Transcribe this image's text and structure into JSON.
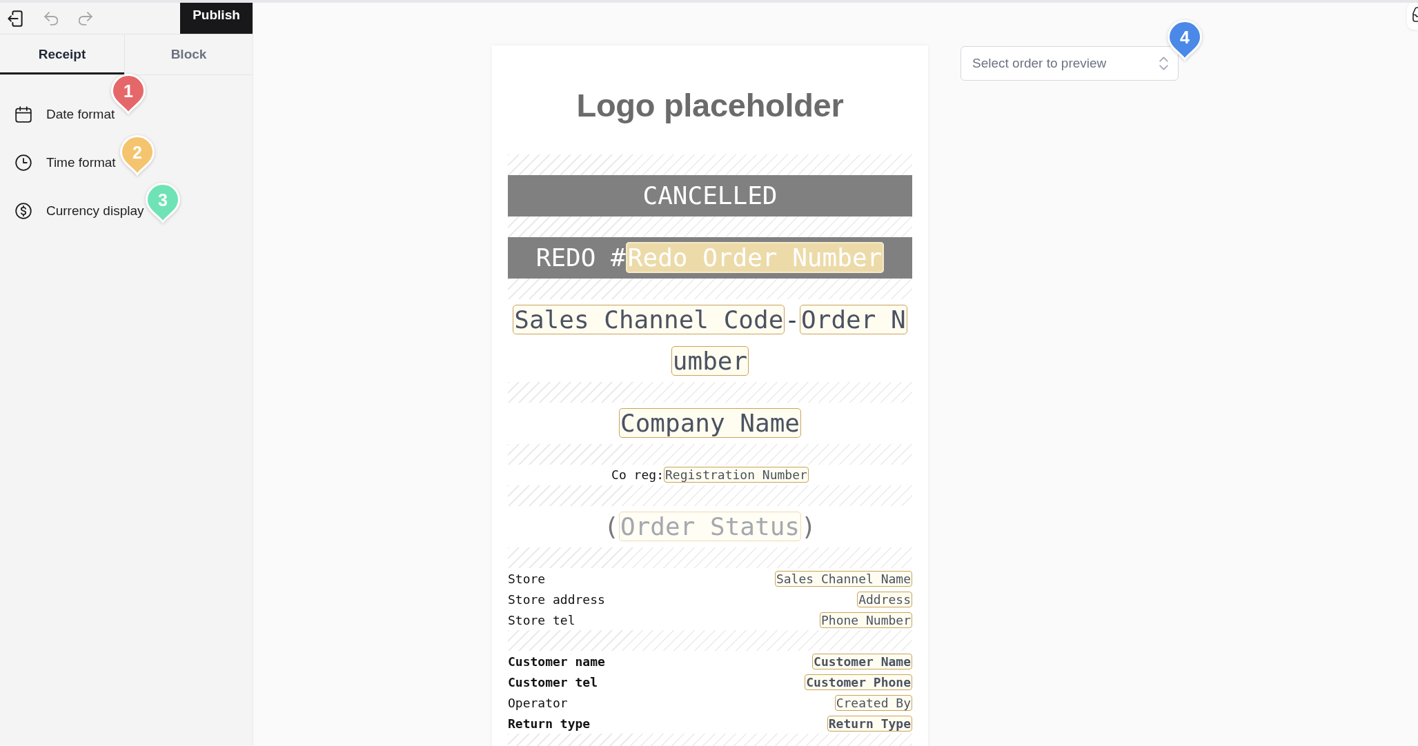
{
  "toolbar": {
    "buttons": [
      {
        "kind": "exit",
        "disabled": false
      },
      {
        "kind": "undo",
        "disabled": true
      },
      {
        "kind": "redo",
        "disabled": true
      }
    ],
    "publish": "Publish"
  },
  "tabs": [
    {
      "label": "Receipt",
      "selected": true
    },
    {
      "label": "Block",
      "selected": false
    }
  ],
  "settings": [
    {
      "kind": "date",
      "label": "Date format",
      "marker": {
        "label": "1",
        "color": "#e5676a"
      }
    },
    {
      "kind": "time",
      "label": "Time format",
      "marker": {
        "label": "2",
        "color": "#f4c46e"
      }
    },
    {
      "kind": "currency",
      "label": "Currency display",
      "marker": {
        "label": "3",
        "color": "#6fe3b5"
      }
    }
  ],
  "receipt": {
    "logo": "Logo placeholder",
    "blocks": [
      {
        "kind": "spacer"
      },
      {
        "kind": "banner",
        "parts": [
          {
            "kind": "text",
            "text": "CANCELLED"
          }
        ]
      },
      {
        "kind": "spacer"
      },
      {
        "kind": "banner",
        "parts": [
          {
            "kind": "text",
            "text": "REDO #"
          },
          {
            "kind": "field",
            "text": "Redo Order Number"
          }
        ]
      },
      {
        "kind": "spacer"
      },
      {
        "kind": "heading",
        "parts": [
          {
            "kind": "field",
            "text": "Sales Channel Code"
          },
          {
            "kind": "text",
            "text": "-"
          },
          {
            "kind": "field",
            "lines": [
              "Order N",
              "umber"
            ]
          }
        ]
      },
      {
        "kind": "spacer"
      },
      {
        "kind": "heading",
        "parts": [
          {
            "kind": "field",
            "text": "Company Name"
          }
        ]
      },
      {
        "kind": "spacer"
      },
      {
        "kind": "line",
        "parts": [
          {
            "kind": "text",
            "text": "Co reg:"
          },
          {
            "kind": "field",
            "text": "Registration Number"
          }
        ]
      },
      {
        "kind": "spacer"
      },
      {
        "kind": "status",
        "parts": [
          {
            "kind": "text",
            "text": "("
          },
          {
            "kind": "field",
            "text": "Order Status"
          },
          {
            "kind": "text",
            "text": ")"
          }
        ]
      },
      {
        "kind": "spacer"
      },
      {
        "kind": "rows",
        "rows": [
          {
            "label": "Store",
            "value": "Sales Channel Name",
            "bold": false
          },
          {
            "label": "Store address",
            "value": "Address",
            "bold": false
          },
          {
            "label": "Store tel",
            "value": "Phone Number",
            "bold": false
          }
        ]
      },
      {
        "kind": "spacer"
      },
      {
        "kind": "rows",
        "rows": [
          {
            "label": "Customer name",
            "value": "Customer Name",
            "bold": true
          },
          {
            "label": "Customer tel",
            "value": "Customer Phone",
            "bold": true
          },
          {
            "label": "Operator",
            "value": "Created By",
            "bold": false
          },
          {
            "label": "Return type",
            "value": "Return Type",
            "bold": true
          }
        ]
      },
      {
        "kind": "spacer"
      }
    ]
  },
  "preview": {
    "placeholder": "Select order to preview",
    "marker": {
      "label": "4",
      "color": "#4a89e8"
    }
  }
}
